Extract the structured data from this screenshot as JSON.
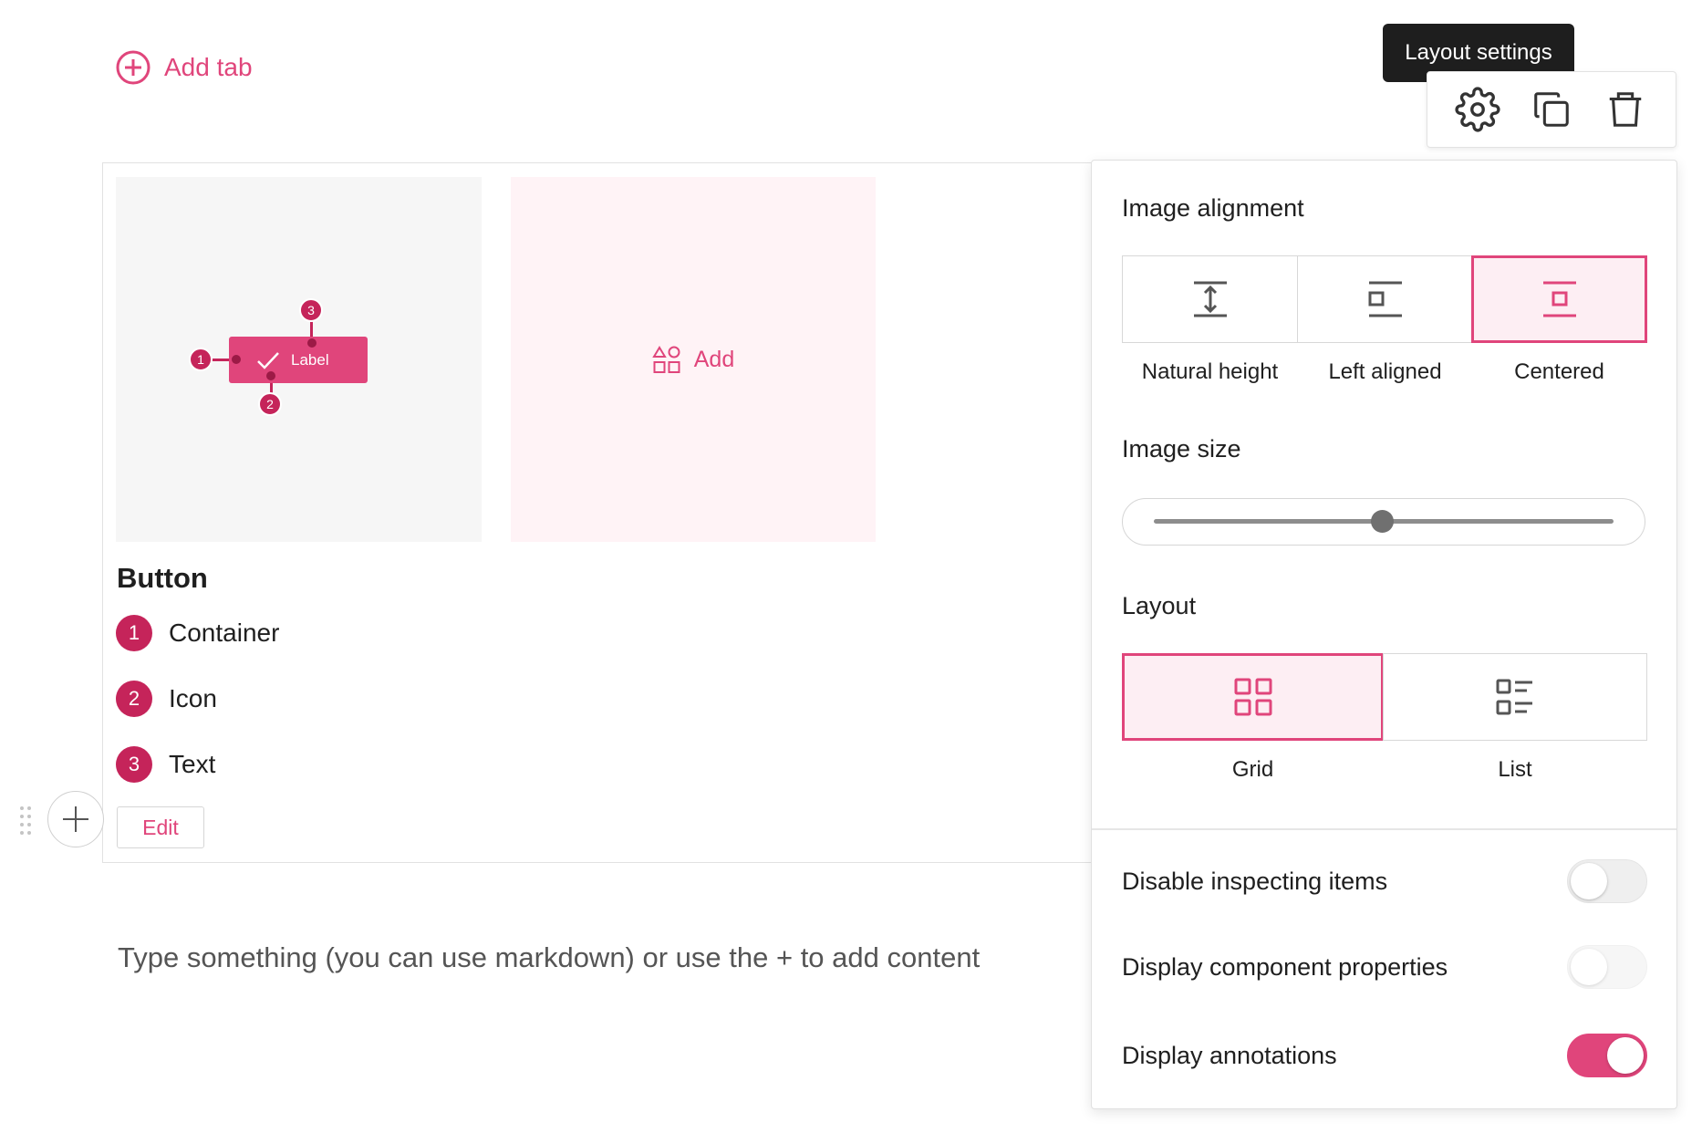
{
  "header": {
    "add_tab_label": "Add tab",
    "tooltip": "Layout settings"
  },
  "toolbar": {
    "icons": [
      "gear-icon",
      "copy-icon",
      "trash-icon"
    ]
  },
  "card": {
    "add_label": "Add",
    "preview_button_label": "Label",
    "pins": [
      "1",
      "2",
      "3"
    ],
    "title": "Button",
    "legend": [
      {
        "num": "1",
        "label": "Container"
      },
      {
        "num": "2",
        "label": "Icon"
      },
      {
        "num": "3",
        "label": "Text"
      }
    ],
    "edit_label": "Edit"
  },
  "editor": {
    "placeholder": "Type something (you can use markdown) or use the + to add content"
  },
  "panel": {
    "image_alignment": {
      "title": "Image alignment",
      "options": [
        {
          "label": "Natural height",
          "icon": "natural-height-icon",
          "selected": false
        },
        {
          "label": "Left aligned",
          "icon": "left-aligned-icon",
          "selected": false
        },
        {
          "label": "Centered",
          "icon": "centered-icon",
          "selected": true
        }
      ]
    },
    "image_size": {
      "title": "Image size",
      "value_fraction": 0.5
    },
    "layout": {
      "title": "Layout",
      "options": [
        {
          "label": "Grid",
          "icon": "grid-icon",
          "selected": true
        },
        {
          "label": "List",
          "icon": "list-icon",
          "selected": false
        }
      ]
    },
    "toggles": [
      {
        "label": "Disable inspecting items",
        "on": false
      },
      {
        "label": "Display component properties",
        "on": false
      },
      {
        "label": "Display annotations",
        "on": true
      }
    ]
  },
  "colors": {
    "accent": "#e0457b",
    "pin": "#c5245a"
  }
}
